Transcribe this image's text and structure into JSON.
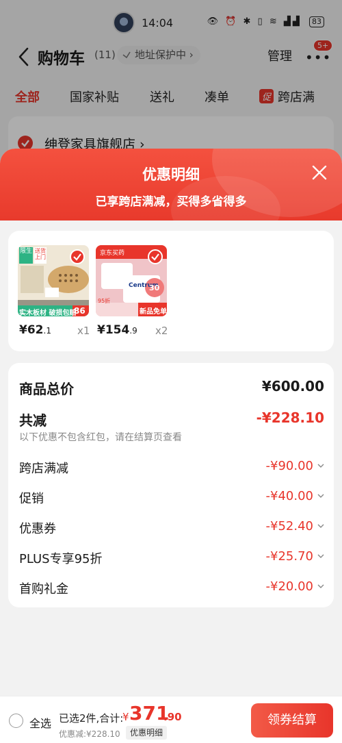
{
  "status_bar": {
    "time": "14:04",
    "icons": "👁 ⏰ ✱ ▯ ≋ ▟▟",
    "battery": "83"
  },
  "header": {
    "title": "购物车",
    "count": "(11)",
    "address_pill": "地址保护中",
    "address_chevron": "›",
    "manage": "管理",
    "more": "•••",
    "badge": "5+"
  },
  "tabs": [
    {
      "label": "全部",
      "active": true
    },
    {
      "label": "国家补贴"
    },
    {
      "label": "送礼"
    },
    {
      "label": "凑单"
    },
    {
      "label": "跨店满",
      "promo_tag": "促"
    }
  ],
  "store": {
    "name": "绅登家具旗舰店 ›"
  },
  "modal": {
    "title": "优惠明细",
    "subtitle": "已享跨店满减，买得多省得多",
    "products": [
      {
        "price_int": "¥62",
        "price_dec": ".1",
        "qty": "x1",
        "thumb": {
          "tag1": "限生",
          "tag2": "送货上门",
          "banner": "实木板材 破损包赔",
          "num": "86"
        }
      },
      {
        "price_int": "¥154",
        "price_dec": ".9",
        "qty": "x2",
        "thumb": {
          "tag1": "京东买药",
          "brand": "Centrum",
          "promo": "新品免单",
          "badge": "95折",
          "num": "30"
        }
      }
    ],
    "summary": {
      "total_label": "商品总价",
      "total_value": "¥600.00",
      "reduce_label": "共减",
      "reduce_value": "-¥228.10",
      "note": "以下优惠不包含红包，请在结算页查看",
      "items": [
        {
          "label": "跨店满减",
          "value": "-¥90.00"
        },
        {
          "label": "促销",
          "value": "-¥40.00"
        },
        {
          "label": "优惠券",
          "value": "-¥52.40"
        },
        {
          "label": "PLUS专享95折",
          "value": "-¥25.70"
        },
        {
          "label": "首购礼金",
          "value": "-¥20.00"
        }
      ]
    }
  },
  "bottom_bar": {
    "select_all": "全选",
    "selected_text": "已选2件,合计:",
    "currency": "¥",
    "total_int": "371",
    "total_dec": ".90",
    "discount_text": "优惠减:¥228.10",
    "detail_chip": "优惠明细",
    "checkout": "领券结算"
  },
  "colors": {
    "accent": "#e8352b",
    "modal_header": "#f4513f",
    "muted": "#888888"
  }
}
